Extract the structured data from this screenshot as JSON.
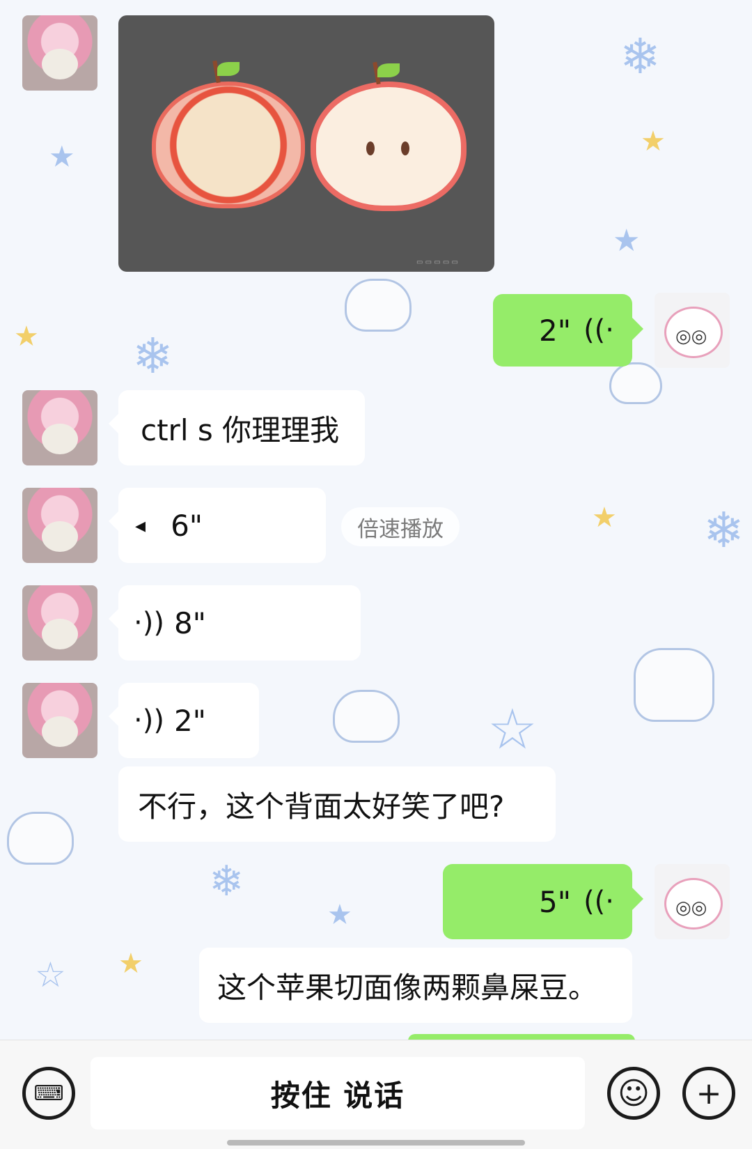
{
  "colors": {
    "accent_green": "#95ec69",
    "background": "#f4f7fc"
  },
  "messages": {
    "m2_duration": "2\"",
    "m3_text": "ctrl s 你理理我",
    "m4_duration": "6\"",
    "m4_speed_label": "倍速播放",
    "m5_duration": "8\"",
    "m6_duration": "2\"",
    "m7_text": "不行，这个背面太好笑了吧?",
    "m8_duration": "5\"",
    "m9_text": "这个苹果切面像两颗鼻屎豆。"
  },
  "icons": {
    "keyboard": "keyboard-icon",
    "emoji": "emoji-icon",
    "plus": "plus-icon",
    "voice": "voice-wave-icon"
  },
  "input_bar": {
    "hold_to_talk_label": "按住 说话"
  }
}
